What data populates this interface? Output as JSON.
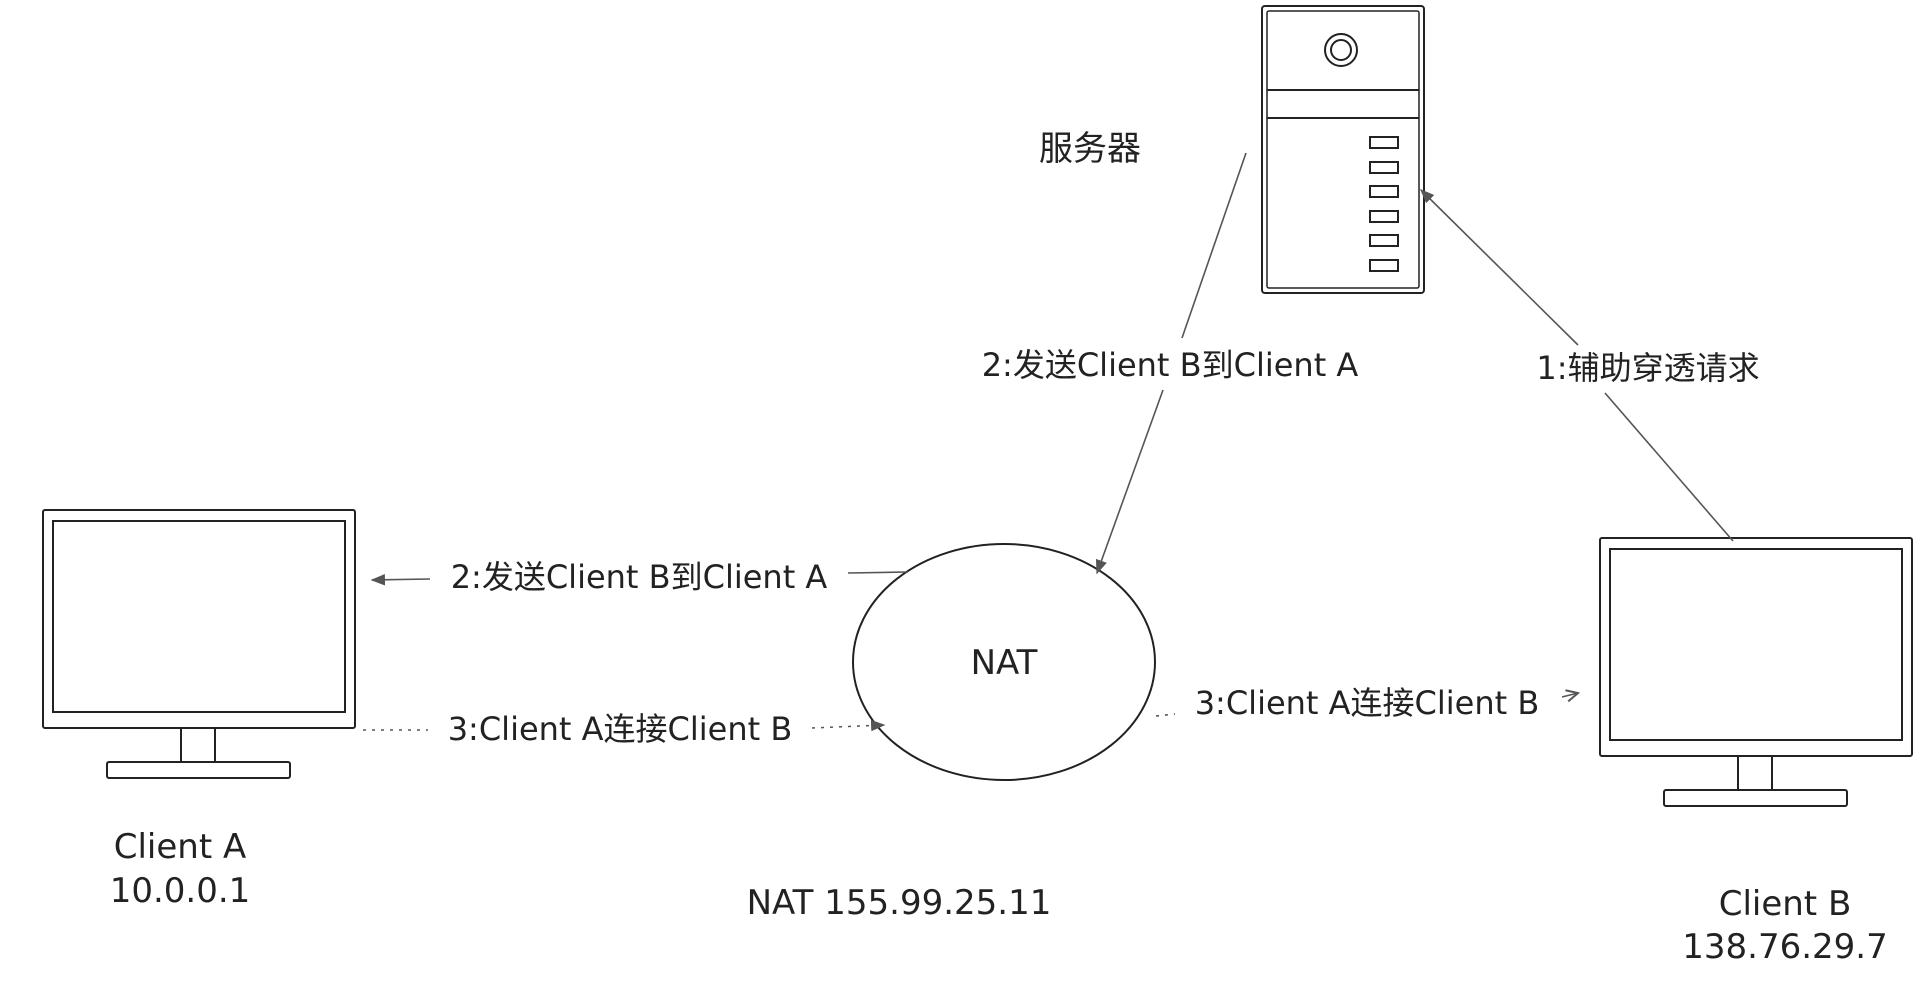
{
  "labels": {
    "server": "服务器",
    "edge_server_to_nat": "2:发送Client B到Client A",
    "edge_b_to_server": "1:辅助穿透请求",
    "edge_nat_to_a": "2:发送Client B到Client A",
    "edge_a_to_nat": "3:Client A连接Client B",
    "edge_nat_to_b": "3:Client A连接Client B",
    "nat_node": "NAT",
    "nat_caption": "NAT 155.99.25.11",
    "client_a_name": "Client A",
    "client_a_ip": "10.0.0.1",
    "client_b_name": "Client B",
    "client_b_ip": "138.76.29.7"
  },
  "colors": {
    "stroke": "#222222",
    "edge": "#555555"
  },
  "icons": {
    "server": "server-tower-icon",
    "client_a": "monitor-icon",
    "client_b": "monitor-icon"
  }
}
